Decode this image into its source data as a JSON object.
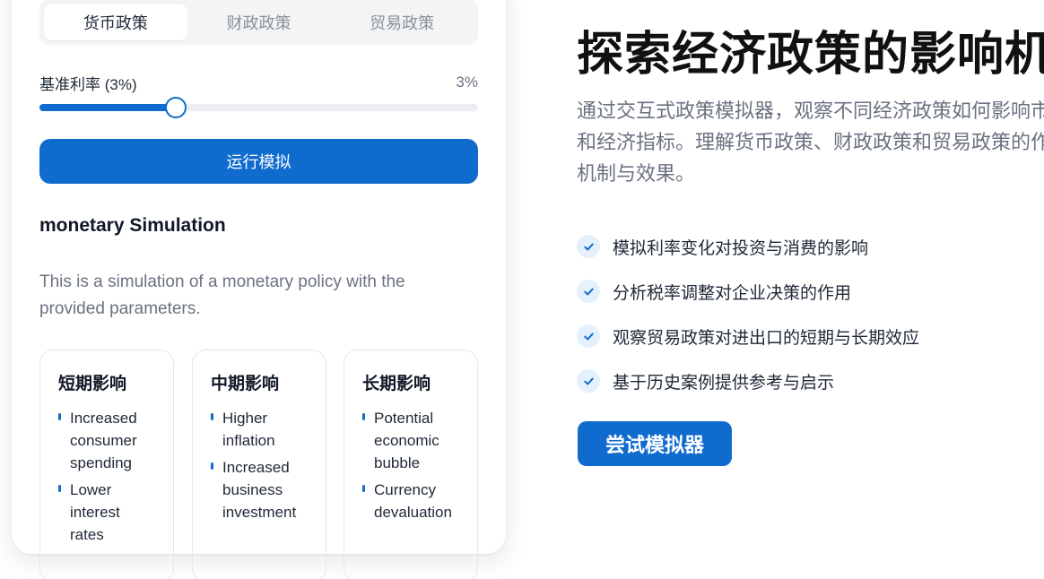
{
  "simulator": {
    "tabs": [
      {
        "label": "货币政策",
        "active": true
      },
      {
        "label": "财政政策",
        "active": false
      },
      {
        "label": "贸易政策",
        "active": false
      }
    ],
    "slider": {
      "label": "基准利率 (3%)",
      "value_text": "3%",
      "fill_fraction": 0.31
    },
    "run_button": "运行模拟",
    "result_title": "monetary Simulation",
    "result_description": "This is a simulation of a monetary policy with the provided parameters.",
    "impacts": [
      {
        "title": "短期影响",
        "items": [
          "Increased consumer spending",
          "Lower interest rates"
        ]
      },
      {
        "title": "中期影响",
        "items": [
          "Higher inflation",
          "Increased business investment"
        ]
      },
      {
        "title": "长期影响",
        "items": [
          "Potential economic bubble",
          "Currency devaluation"
        ]
      }
    ]
  },
  "hero": {
    "headline": "探索经济政策的影响机制",
    "intro": "通过交互式政策模拟器，观察不同经济政策如何影响市场和经济指标。理解货币政策、财政政策和贸易政策的作用机制与效果。",
    "features": [
      "模拟利率变化对投资与消费的影响",
      "分析税率调整对企业决策的作用",
      "观察贸易政策对进出口的短期与长期效应",
      "基于历史案例提供参考与启示"
    ],
    "cta": "尝试模拟器"
  },
  "colors": {
    "accent": "#0f6cce",
    "check_bg": "#e4f0fb",
    "muted_text": "#6b7280"
  }
}
